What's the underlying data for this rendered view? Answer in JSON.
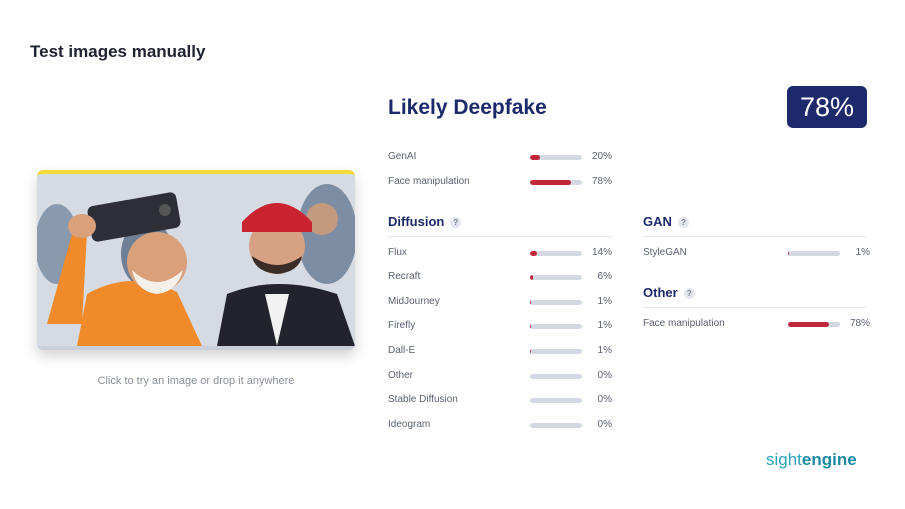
{
  "page": {
    "title": "Test images manually"
  },
  "upload": {
    "caption": "Click to try an image or drop it anywhere"
  },
  "result": {
    "verdict": "Likely Deepfake",
    "score": "78%",
    "summary": [
      {
        "label": "GenAI",
        "value": 20,
        "text": "20%"
      },
      {
        "label": "Face manipulation",
        "value": 78,
        "text": "78%"
      }
    ],
    "diffusion": {
      "title": "Diffusion",
      "help": "?",
      "items": [
        {
          "label": "Flux",
          "value": 14,
          "text": "14%"
        },
        {
          "label": "Recraft",
          "value": 6,
          "text": "6%"
        },
        {
          "label": "MidJourney",
          "value": 1,
          "text": "1%"
        },
        {
          "label": "Firefly",
          "value": 1,
          "text": "1%"
        },
        {
          "label": "Dall-E",
          "value": 1,
          "text": "1%"
        },
        {
          "label": "Other",
          "value": 0,
          "text": "0%"
        },
        {
          "label": "Stable Diffusion",
          "value": 0,
          "text": "0%"
        },
        {
          "label": "Ideogram",
          "value": 0,
          "text": "0%"
        }
      ]
    },
    "gan": {
      "title": "GAN",
      "help": "?",
      "items": [
        {
          "label": "StyleGAN",
          "value": 1,
          "text": "1%"
        }
      ]
    },
    "other": {
      "title": "Other",
      "help": "?",
      "items": [
        {
          "label": "Face manipulation",
          "value": 78,
          "text": "78%"
        }
      ]
    }
  },
  "brand": {
    "part1": "sight",
    "part2": "engine"
  },
  "colors": {
    "accent": "#1c2a6b",
    "bar_fill": "#c0283a",
    "bar_track": "#d4d8e2",
    "brand": "#2aa3b8"
  }
}
